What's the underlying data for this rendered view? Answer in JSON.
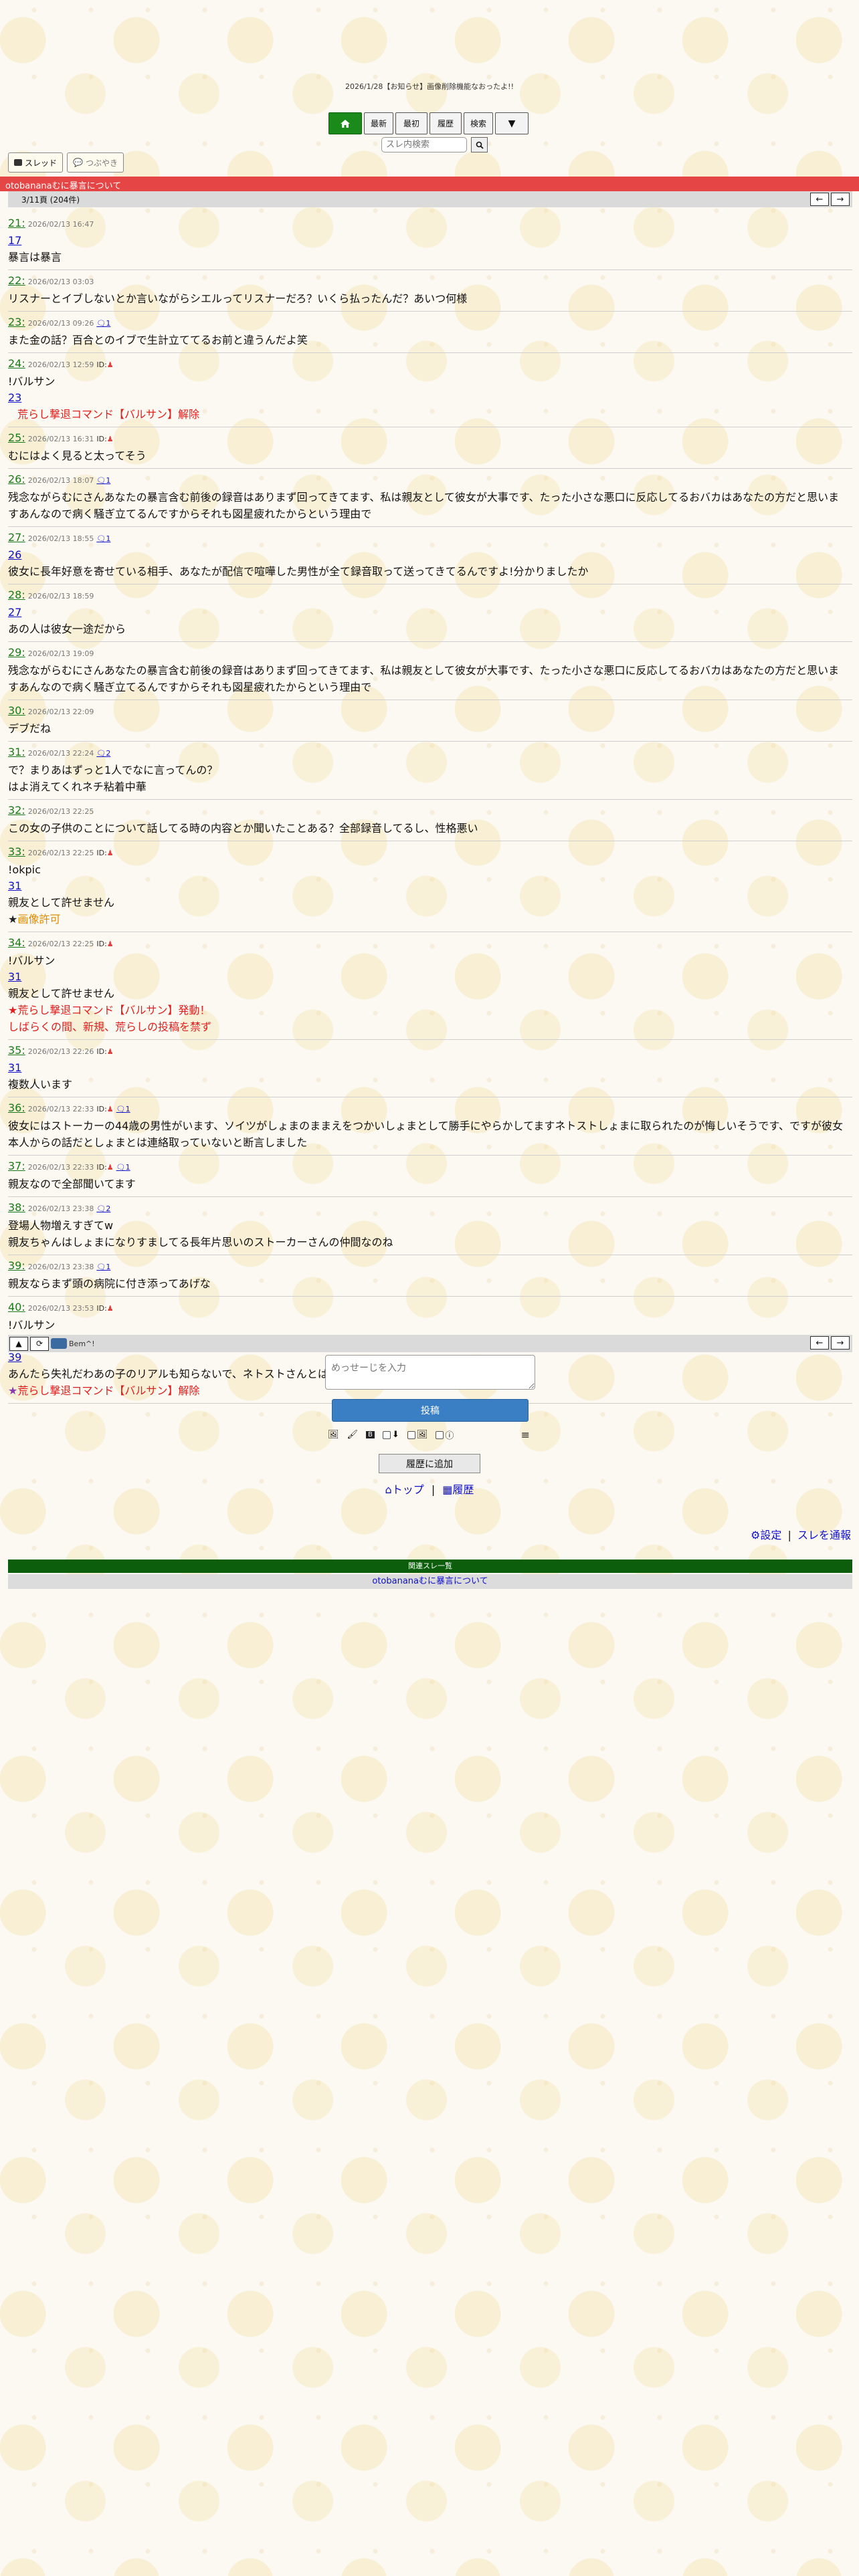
{
  "header": {
    "notice": "2026/1/28【お知らせ】画像削除機能なおったよ!!",
    "nav": {
      "latest": "最新",
      "first": "最初",
      "history": "履歴",
      "search": "検索",
      "more": "▼"
    },
    "search_placeholder": "スレ内検索",
    "mode_thread": "スレッド",
    "mode_tweet": "つぶやき",
    "thread_title": "otobananaむに暴言について",
    "page_info": "3/11頁 (204件)"
  },
  "posts": [
    {
      "num": "21:",
      "date": "2026/02/13 16:47",
      "anchor": "17",
      "lines": [
        "暴言は暴言"
      ]
    },
    {
      "num": "22:",
      "date": "2026/02/13 03:03",
      "lines": [
        "リスナーとイブしないとか言いながらシエルってリスナーだろ？いくら払ったんだ？あいつ何様"
      ]
    },
    {
      "num": "23:",
      "date": "2026/02/13 09:26",
      "replies": "1",
      "lines": [
        "また金の話？百合とのイブで生計立ててるお前と違うんだよ笑"
      ]
    },
    {
      "num": "24:",
      "date": "2026/02/13 12:59",
      "id": "ID:",
      "command": "!バルサン",
      "anchor": "23",
      "red": "荒らし撃退コマンド【バルサン】解除"
    },
    {
      "num": "25:",
      "date": "2026/02/13 16:31",
      "id": "ID:",
      "lines": [
        "むにはよく見ると太ってそう"
      ]
    },
    {
      "num": "26:",
      "date": "2026/02/13 18:07",
      "replies": "1",
      "lines": [
        "残念ながらむにさんあなたの暴言含む前後の録音はありまず回ってきてます、私は親友として彼女が大事です、たった小さな悪口に反応してるおバカはあなたの方だと思いま",
        "すあんなので病く騒ぎ立てるんですからそれも図星疲れたからという理由で"
      ]
    },
    {
      "num": "27:",
      "date": "2026/02/13 18:55",
      "replies": "1",
      "anchor": "26",
      "lines": [
        "彼女に長年好意を寄せている相手、あなたが配信で喧嘩した男性が全て録音取って送ってきてるんですよ!分かりましたか"
      ]
    },
    {
      "num": "28:",
      "date": "2026/02/13 18:59",
      "anchor": "27",
      "lines": [
        "あの人は彼女一途だから"
      ]
    },
    {
      "num": "29:",
      "date": "2026/02/13 19:09",
      "lines": [
        "残念ながらむにさんあなたの暴言含む前後の録音はありまず回ってきてます、私は親友として彼女が大事です、たった小さな悪口に反応してるおバカはあなたの方だと思いま",
        "すあんなので病く騒ぎ立てるんですからそれも図星疲れたからという理由で"
      ]
    },
    {
      "num": "30:",
      "date": "2026/02/13 22:09",
      "lines": [
        "デブだね"
      ]
    },
    {
      "num": "31:",
      "date": "2026/02/13 22:24",
      "replies": "2",
      "lines": [
        "で？まりあはずっと1人でなに言ってんの？",
        "はよ消えてくれネチ粘着中華"
      ]
    },
    {
      "num": "32:",
      "date": "2026/02/13 22:25",
      "lines": [
        "この女の子供のことについて話してる時の内容とか聞いたことある？全部録音してるし、性格悪い"
      ]
    },
    {
      "num": "33:",
      "date": "2026/02/13 22:25",
      "id": "ID:",
      "command": "!okpic",
      "anchor": "31",
      "lines": [
        "親友として許せません"
      ],
      "orange_star": "★",
      "orange": "画像許可"
    },
    {
      "num": "34:",
      "date": "2026/02/13 22:25",
      "id": "ID:",
      "command": "!バルサン",
      "anchor": "31",
      "lines": [
        "親友として許せません"
      ],
      "red_lines": [
        "★荒らし撃退コマンド【バルサン】発動！",
        "しばらくの間、新規、荒らしの投稿を禁ず"
      ]
    },
    {
      "num": "35:",
      "date": "2026/02/13 22:26",
      "id": "ID:",
      "anchor": "31",
      "lines": [
        "複数人います"
      ]
    },
    {
      "num": "36:",
      "date": "2026/02/13 22:33",
      "id": "ID:",
      "replies": "1",
      "lines": [
        "彼女にはストーカーの44歳の男性がいます、ソイツがしょまのままえをつかいしょまとして勝手にやらかしてますネトストしょまに取られたのが悔しいそうです、ですが彼女",
        "本人からの話だとしょまとは連絡取っていないと断言しました"
      ]
    },
    {
      "num": "37:",
      "date": "2026/02/13 22:33",
      "id": "ID:",
      "replies": "1",
      "lines": [
        "親友なので全部聞いてます"
      ]
    },
    {
      "num": "38:",
      "date": "2026/02/13 23:38",
      "replies": "2",
      "lines": [
        "登場人物増えすぎてw",
        "親友ちゃんはしょまになりすましてる長年片思いのストーカーさんの仲間なのね"
      ]
    },
    {
      "num": "39:",
      "date": "2026/02/13 23:38",
      "replies": "1",
      "lines": [
        "親友ならまず頭の病院に付き添ってあげな"
      ]
    },
    {
      "num": "40:",
      "date": "2026/02/13 23:53",
      "id": "ID:",
      "command": "!バルサン",
      "anchor": "38",
      "anchor2": "39",
      "lines": [
        "あんたら失礼だわあの子のリアルも知らないで、ネトストさんとはネットだけ出そう会う気もないそうよ"
      ],
      "purple_star": "★",
      "red_tail": "荒らし撃退コマンド【バルサン】解除"
    }
  ],
  "bottom": {
    "emoji_label": "Bem^!",
    "compose_placeholder": "めっせーじを入力",
    "submit_label": "投稿",
    "history_add": "履歴に追加",
    "top_link": "トップ",
    "history_link": "履歴",
    "sep": "|",
    "settings_link": "設定",
    "report_link": "スレを通報",
    "related_head": "関連スレ一覧",
    "related_item": "otobananaむに暴言について"
  },
  "colors": {
    "title_bar": "#e64545",
    "home_button": "#1a8a1a",
    "submit_button": "#3a7fc4",
    "related_head": "#0c5e0c",
    "post_number": "#1a7a1a",
    "link": "#1010c8"
  }
}
